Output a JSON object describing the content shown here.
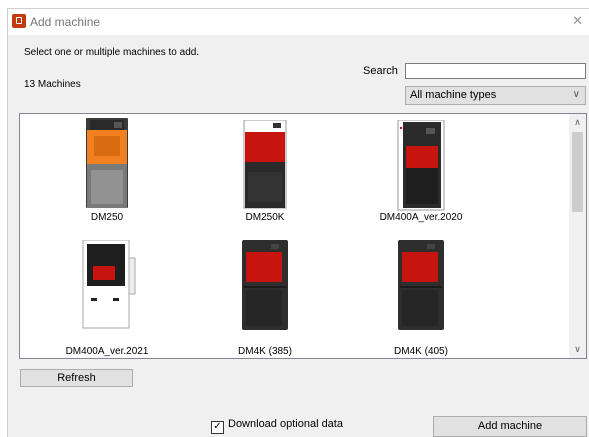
{
  "window": {
    "title": "Add machine",
    "close_glyph": "✕"
  },
  "header": {
    "instruction": "Select one or multiple machines to add.",
    "count": "13 Machines",
    "search_label": "Search",
    "search_value": "",
    "type_filter": "All machine types"
  },
  "machines": [
    {
      "name": "DM250",
      "icon": "printer-orange-icon"
    },
    {
      "name": "DM250K",
      "icon": "printer-red-icon"
    },
    {
      "name": "DM400A_ver.2020",
      "icon": "printer-red-tall-icon"
    },
    {
      "name": "DM400A_ver.2021",
      "icon": "printer-white-icon"
    },
    {
      "name": "DM4K (385)",
      "icon": "printer-dark-icon"
    },
    {
      "name": "DM4K (405)",
      "icon": "printer-dark-icon"
    }
  ],
  "footer": {
    "refresh_label": "Refresh",
    "download_label": "Download optional data",
    "download_checked": true,
    "add_label": "Add machine"
  },
  "colors": {
    "orange": "#f08020",
    "red": "#c8140f",
    "dark": "#2e2e2e"
  }
}
